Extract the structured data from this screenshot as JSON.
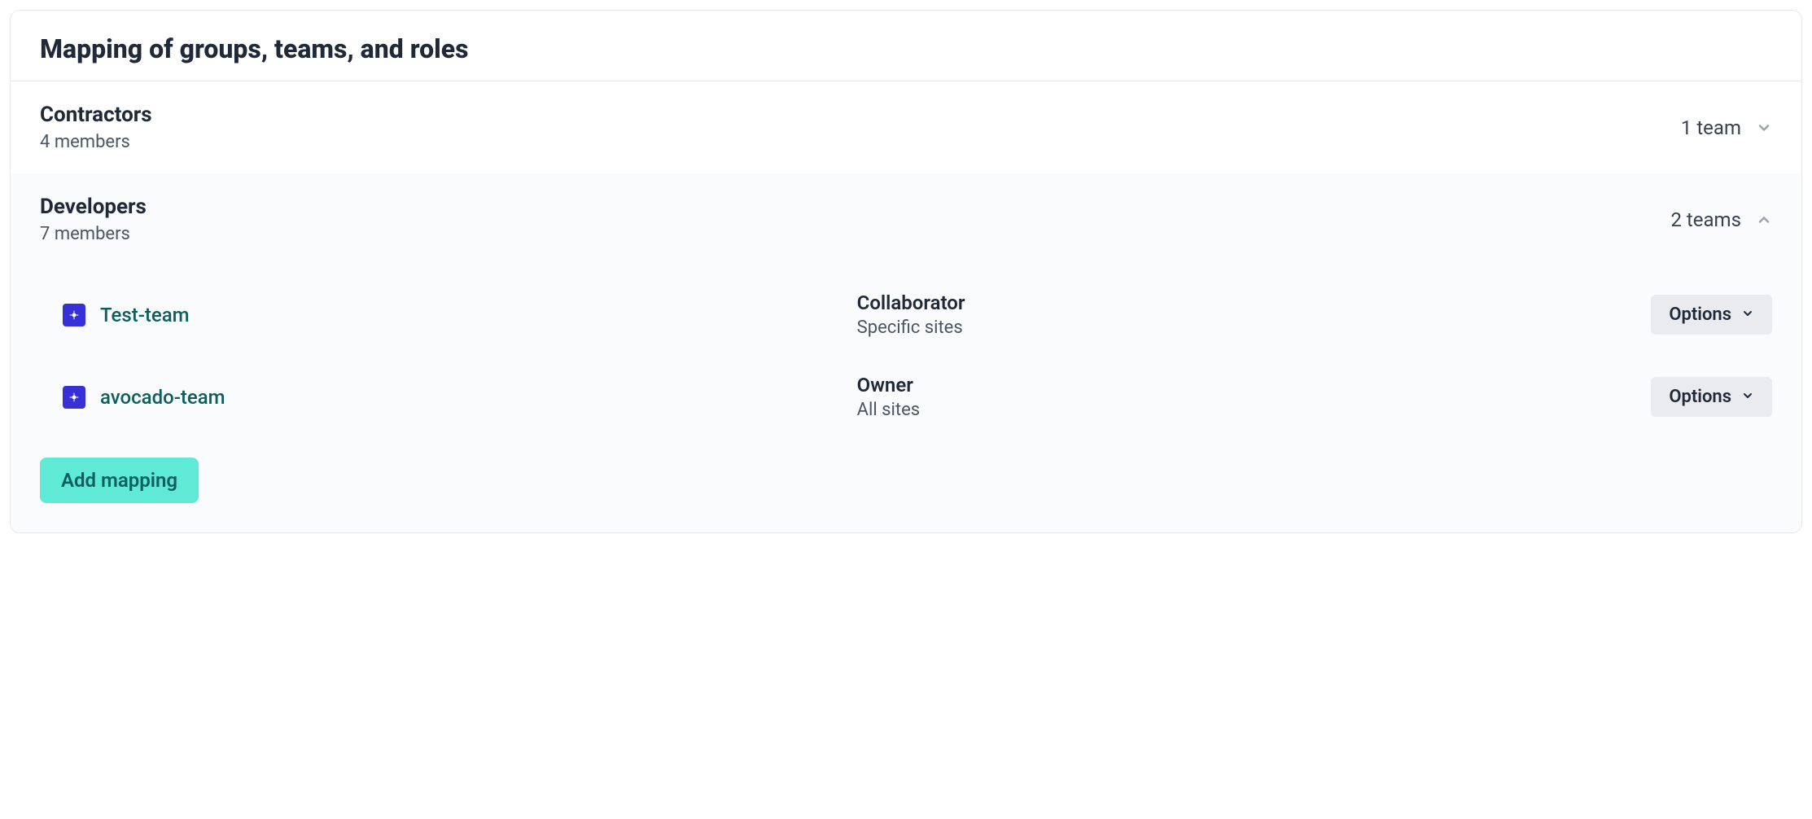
{
  "header": {
    "title": "Mapping of groups, teams, and roles"
  },
  "groups": [
    {
      "name": "Contractors",
      "members_label": "4 members",
      "team_count_label": "1 team",
      "expanded": false
    },
    {
      "name": "Developers",
      "members_label": "7 members",
      "team_count_label": "2 teams",
      "expanded": true,
      "teams": [
        {
          "name": "Test-team",
          "role": "Collaborator",
          "scope": "Specific sites",
          "options_label": "Options"
        },
        {
          "name": "avocado-team",
          "role": "Owner",
          "scope": "All sites",
          "options_label": "Options"
        }
      ]
    }
  ],
  "buttons": {
    "add_mapping": "Add mapping"
  }
}
